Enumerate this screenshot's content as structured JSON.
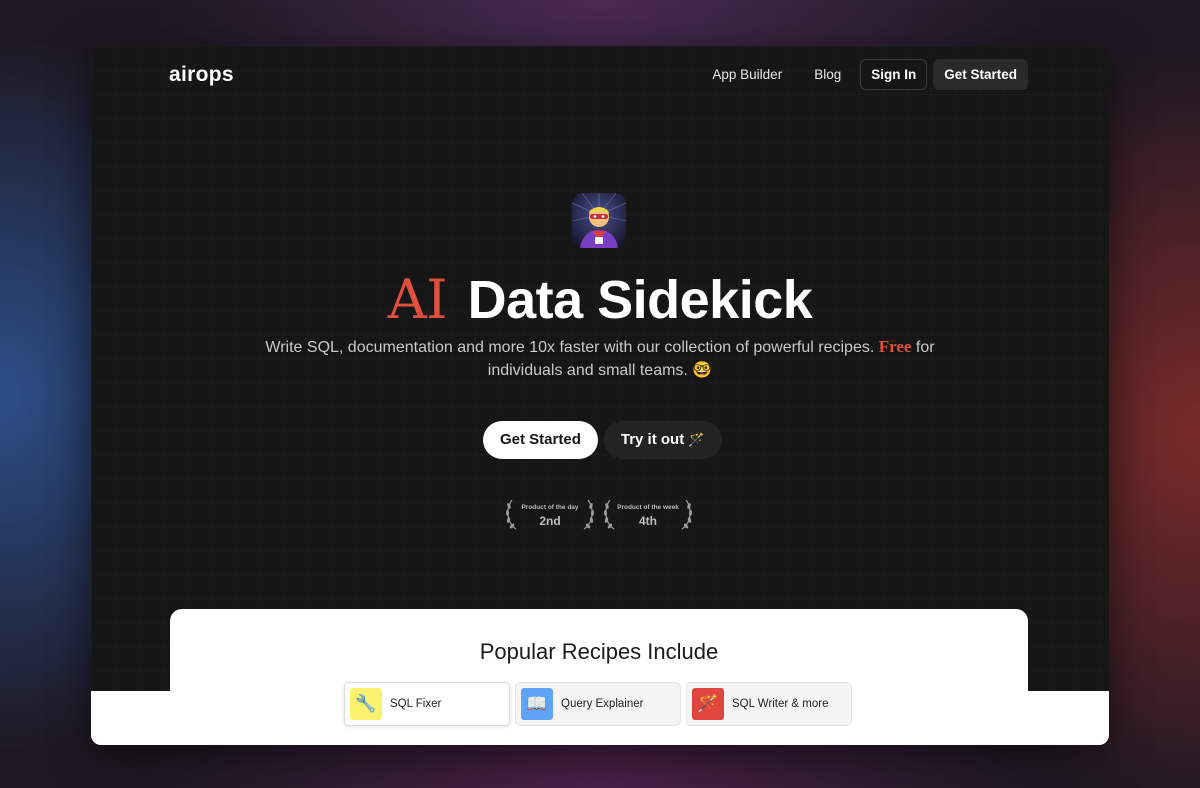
{
  "header": {
    "logo": "airops",
    "nav": {
      "app_builder": "App Builder",
      "blog": "Blog",
      "sign_in": "Sign In",
      "get_started": "Get Started"
    }
  },
  "hero": {
    "avatar_icon": "superhero-icon",
    "title_accent": "AI",
    "title_main": "Data Sidekick",
    "subtitle_before": "Write SQL, documentation and more 10x faster with our collection of powerful recipes.",
    "subtitle_free": "Free",
    "subtitle_after": "for individuals and small teams.",
    "subtitle_emoji": "🤓",
    "cta_primary": "Get Started",
    "cta_secondary": "Try it out",
    "cta_secondary_emoji": "🪄"
  },
  "badges": [
    {
      "title": "Product of the day",
      "rank": "2nd"
    },
    {
      "title": "Product of the week",
      "rank": "4th"
    }
  ],
  "recipes": {
    "title": "Popular Recipes Include",
    "items": [
      {
        "label": "SQL Fixer",
        "icon": "wrench-icon",
        "glyph": "🔧",
        "color": "#faf26c"
      },
      {
        "label": "Query Explainer",
        "icon": "book-icon",
        "glyph": "📖",
        "color": "#5fa3f5"
      },
      {
        "label": "SQL Writer & more",
        "icon": "magic-wand-icon",
        "glyph": "🪄",
        "color": "#e04540"
      }
    ]
  },
  "colors": {
    "accent": "#e0503c",
    "background": "#161616"
  }
}
